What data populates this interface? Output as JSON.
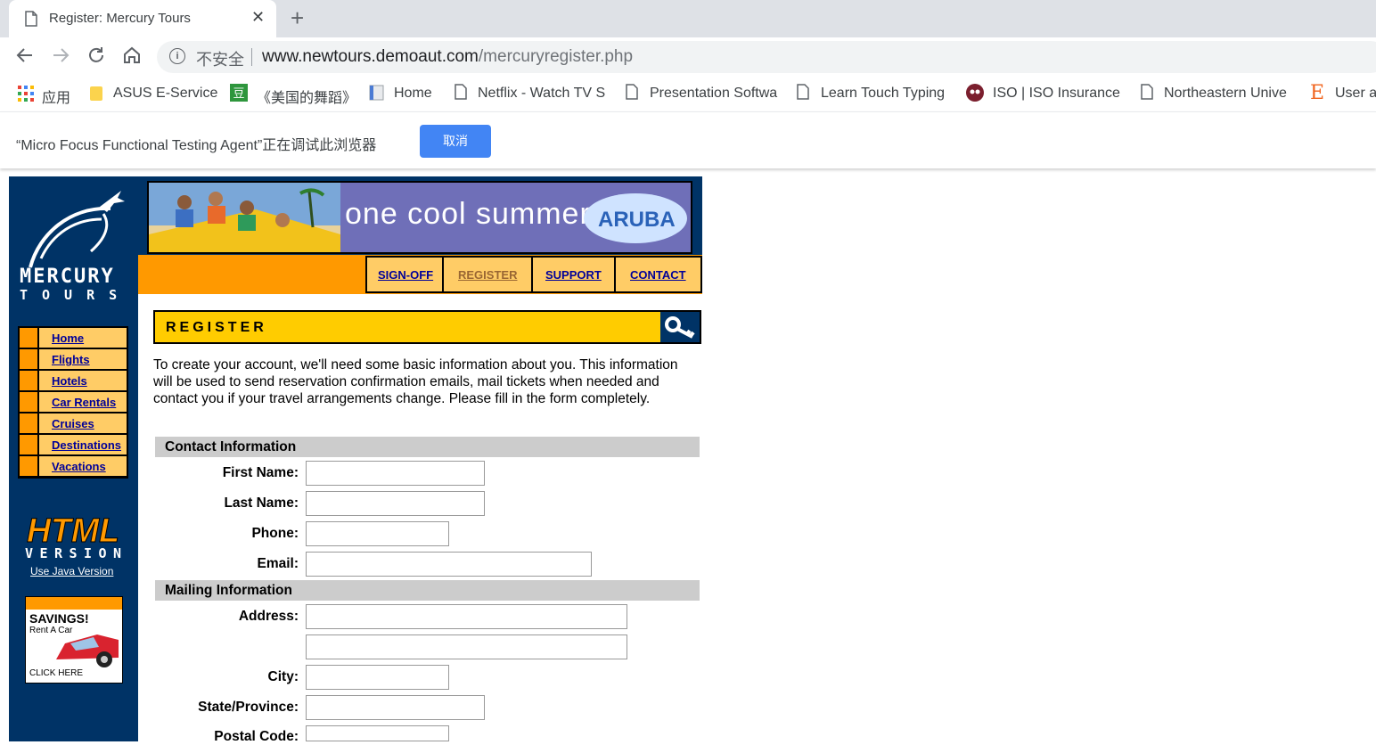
{
  "browser": {
    "tab_title": "Register: Mercury Tours",
    "tab_close": "✕",
    "new_tab": "+",
    "insecure_label": "不安全",
    "url_host": "www.newtours.demoaut.com",
    "url_path": "/mercuryregister.php",
    "bookmarks": [
      {
        "label": "应用",
        "icon": "apps-grid-icon"
      },
      {
        "label": "ASUS E-Service",
        "icon": "folder-icon"
      },
      {
        "label": "《美国的舞蹈》",
        "icon": "douban-icon"
      },
      {
        "label": "Home",
        "icon": "page-icon"
      },
      {
        "label": "Netflix - Watch TV S",
        "icon": "page-icon"
      },
      {
        "label": "Presentation Softwa",
        "icon": "page-icon"
      },
      {
        "label": "Learn Touch Typing",
        "icon": "page-icon"
      },
      {
        "label": "ISO | ISO Insurance",
        "icon": "iso-icon"
      },
      {
        "label": "Northeastern Unive",
        "icon": "page-icon"
      },
      {
        "label": "User a",
        "icon": "etsy-icon"
      }
    ],
    "debug_message": "“Micro Focus Functional Testing Agent”正在调试此浏览器",
    "debug_cancel": "取消"
  },
  "site": {
    "logo_line1": "MERCURY",
    "logo_line2": "TOURS",
    "sidebar_nav": [
      "Home",
      "Flights",
      "Hotels",
      "Car Rentals",
      "Cruises",
      "Destinations",
      "Vacations"
    ],
    "html_version_line1": "HTML",
    "html_version_line2": "VERSION",
    "use_java": "Use Java Version",
    "ad_savings": "SAVINGS!",
    "ad_rent": "Rent A Car",
    "ad_click": "CLICK HERE",
    "banner_text": "one cool summer",
    "banner_brand": "ARUBA",
    "top_nav": [
      "SIGN-OFF",
      "REGISTER",
      "SUPPORT",
      "CONTACT"
    ]
  },
  "register": {
    "header": "REGISTER",
    "intro": "To create your account, we'll need some basic information about you. This information will be used to send reservation confirmation emails, mail tickets when needed and contact you if your travel arrangements change. Please fill in the form completely.",
    "contact_section": "Contact Information",
    "mailing_section": "Mailing Information",
    "fields": {
      "first_name": {
        "label": "First Name:",
        "value": ""
      },
      "last_name": {
        "label": "Last Name:",
        "value": ""
      },
      "phone": {
        "label": "Phone:",
        "value": ""
      },
      "email": {
        "label": "Email:",
        "value": ""
      },
      "address1": {
        "label": "Address:",
        "value": ""
      },
      "address2": {
        "value": ""
      },
      "city": {
        "label": "City:",
        "value": ""
      },
      "state": {
        "label": "State/Province:",
        "value": ""
      },
      "postal": {
        "label": "Postal Code:",
        "value": ""
      }
    }
  },
  "colors": {
    "sidebar_navy": "#003366",
    "orange": "#ff9900",
    "light_orange": "#ffcc66",
    "header_yellow": "#ffcc00",
    "link_blue": "#000099",
    "section_gray": "#cccccc",
    "chrome_button_blue": "#4285f4"
  }
}
